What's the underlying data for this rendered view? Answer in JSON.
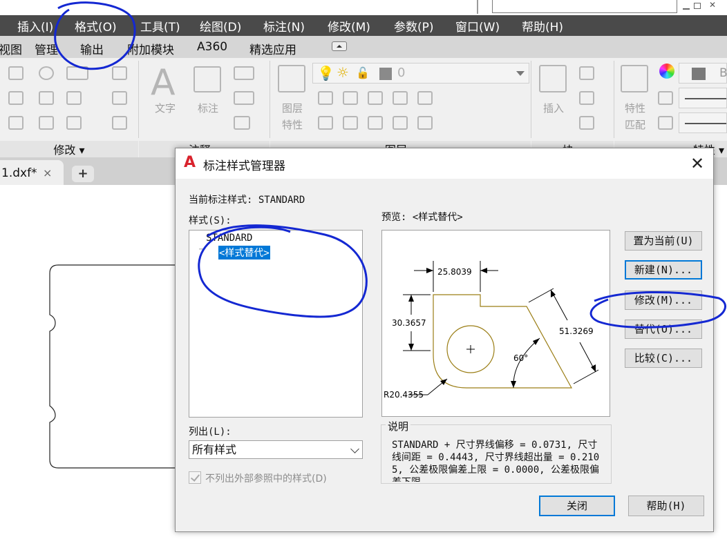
{
  "menubar": {
    "items": [
      "插入(I)",
      "格式(O)",
      "工具(T)",
      "绘图(D)",
      "标注(N)",
      "修改(M)",
      "参数(P)",
      "窗口(W)",
      "帮助(H)"
    ]
  },
  "ribbon_tabs": [
    "视图",
    "管理",
    "输出",
    "附加模块",
    "A360",
    "精选应用"
  ],
  "ribbon": {
    "modify_panel": "修改",
    "annotate_panel": "注释",
    "layers_panel": "图层",
    "block_panel": "块",
    "properties_panel": "特性",
    "text_btn": "文字",
    "dim_btn": "标注",
    "layer_props_btn_1": "图层",
    "layer_props_btn_2": "特性",
    "insert_btn": "插入",
    "match_btn_1": "特性",
    "match_btn_2": "匹配",
    "layer_name": "0",
    "bylayer": "By"
  },
  "doc_tab": {
    "name": "1.dxf*",
    "close": "×",
    "add": "+"
  },
  "dialog": {
    "title": "标注样式管理器",
    "close": "✕",
    "current_style_label": "当前标注样式: STANDARD",
    "styles_label": "样式(S):",
    "styles": [
      "STANDARD",
      "<样式替代>"
    ],
    "preview_label": "预览: <样式替代>",
    "buttons": {
      "set_current": "置为当前(U)",
      "new": "新建(N)...",
      "modify": "修改(M)...",
      "override": "替代(O)...",
      "compare": "比较(C)..."
    },
    "list_label": "列出(L):",
    "list_value": "所有样式",
    "no_xref_label": "不列出外部参照中的样式(D)",
    "description_label": "说明",
    "description": "STANDARD + 尺寸界线偏移 = 0.0731, 尺寸线间距 = 0.4443, 尺寸界线超出量 = 0.2105, 公差极限偏差上限 = 0.0000, 公差极限偏差下限",
    "close_btn": "关闭",
    "help_btn": "帮助(H)",
    "preview_dims": {
      "top": "25.8039",
      "left": "30.3657",
      "diag": "51.3269",
      "angle": "60°",
      "radius": "R20.4355"
    }
  },
  "colors": {
    "menubar": "#4a4a4a",
    "ribbon_tabs": "#d6d6d6",
    "selection": "#0078d7",
    "annotation_ink": "#1428d2",
    "preview_outline": "#9a7d14"
  }
}
